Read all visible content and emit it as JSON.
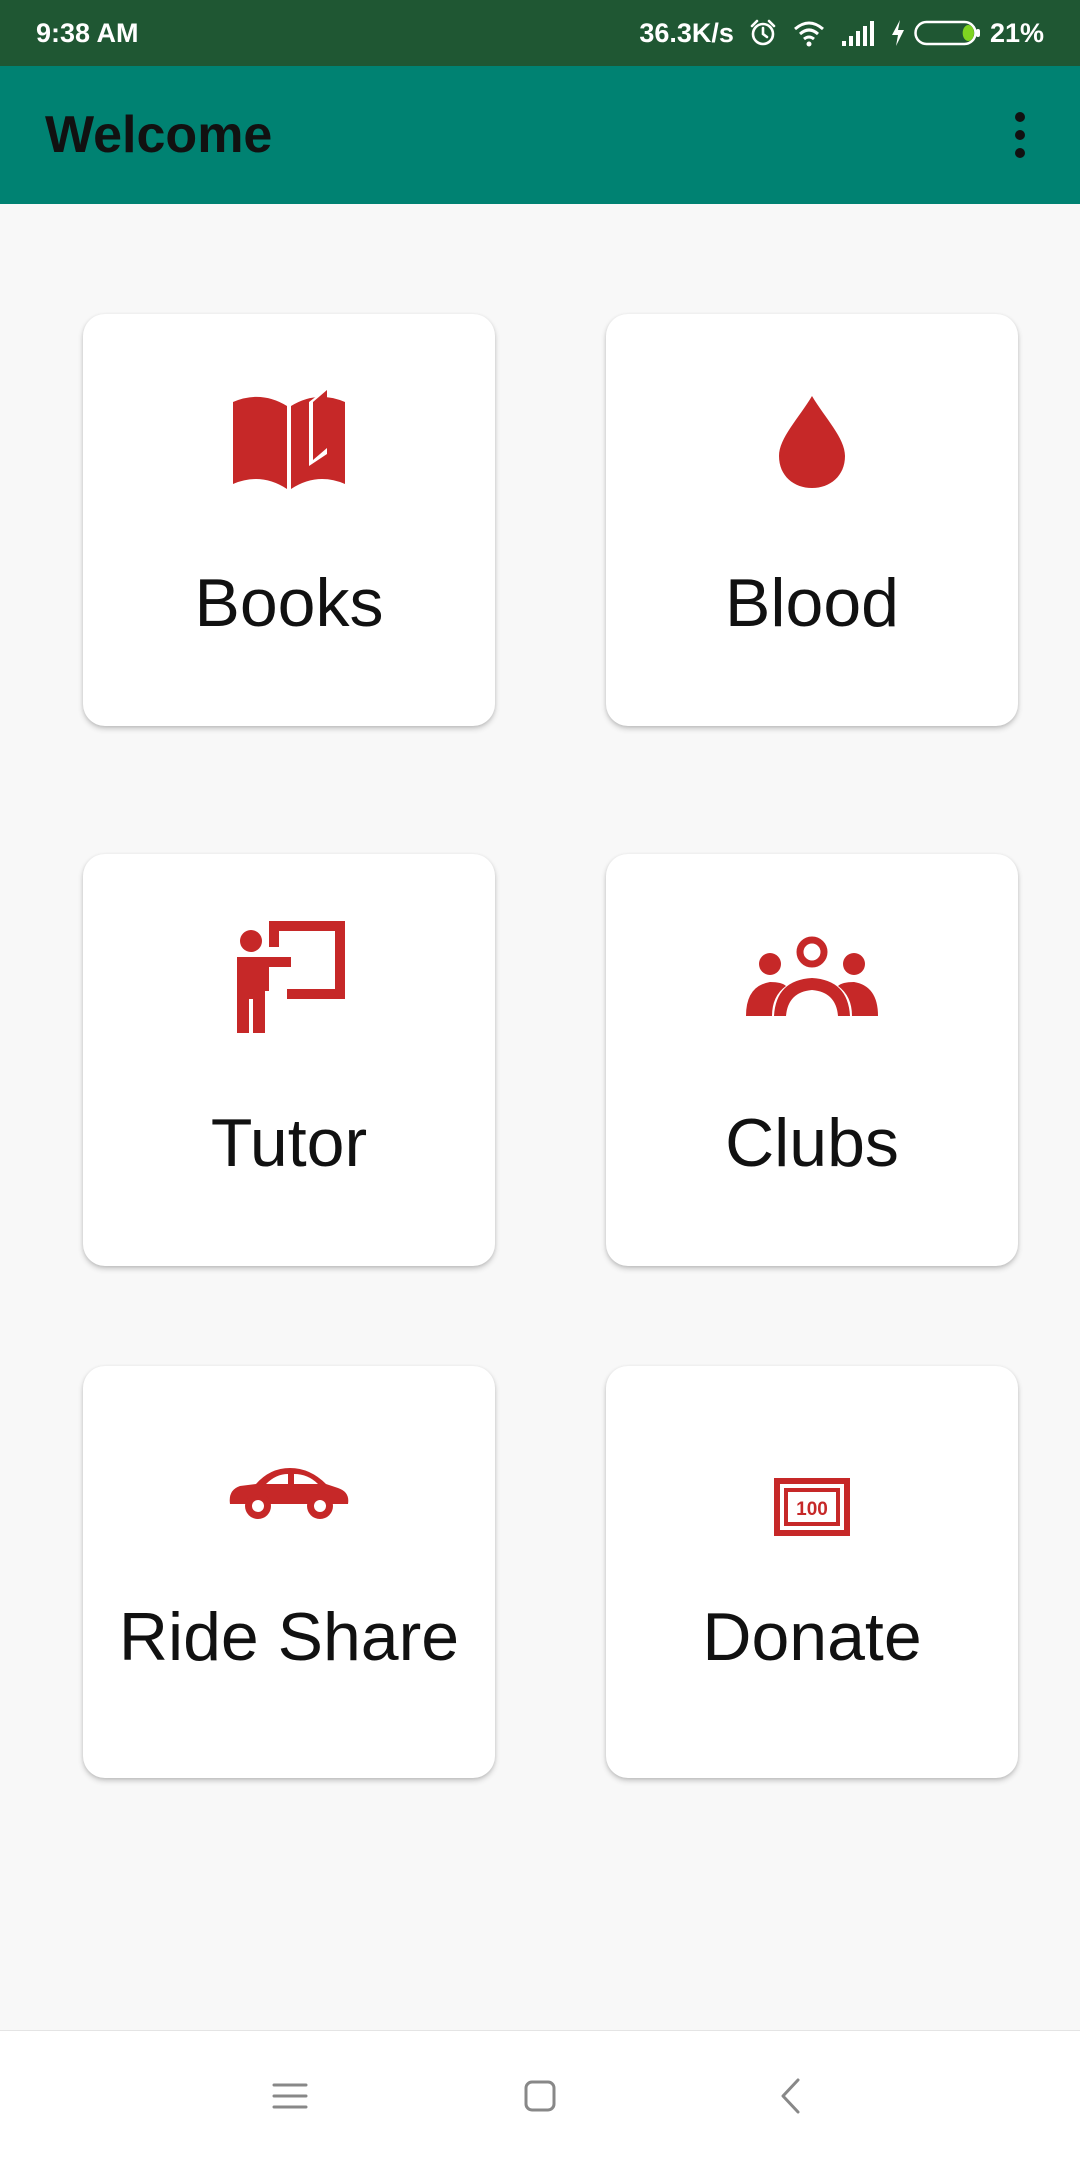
{
  "status_bar": {
    "time": "9:38 AM",
    "net_speed": "36.3K/s",
    "battery": "21%",
    "battery_level": 0.21,
    "background_color": "#1f5733"
  },
  "app_bar": {
    "title": "Welcome",
    "background_color": "#008272"
  },
  "accent_color": "#c62828",
  "tiles": [
    {
      "label": "Books",
      "icon": "book-icon"
    },
    {
      "label": "Blood",
      "icon": "blood-drop-icon"
    },
    {
      "label": "Tutor",
      "icon": "teacher-icon"
    },
    {
      "label": "Clubs",
      "icon": "group-icon"
    },
    {
      "label": "Ride Share",
      "icon": "car-icon"
    },
    {
      "label": "Donate",
      "icon": "money-icon"
    }
  ],
  "money_icon_text": "100",
  "nav_bar": {
    "buttons": [
      "menu-icon",
      "home-icon",
      "back-icon"
    ]
  }
}
